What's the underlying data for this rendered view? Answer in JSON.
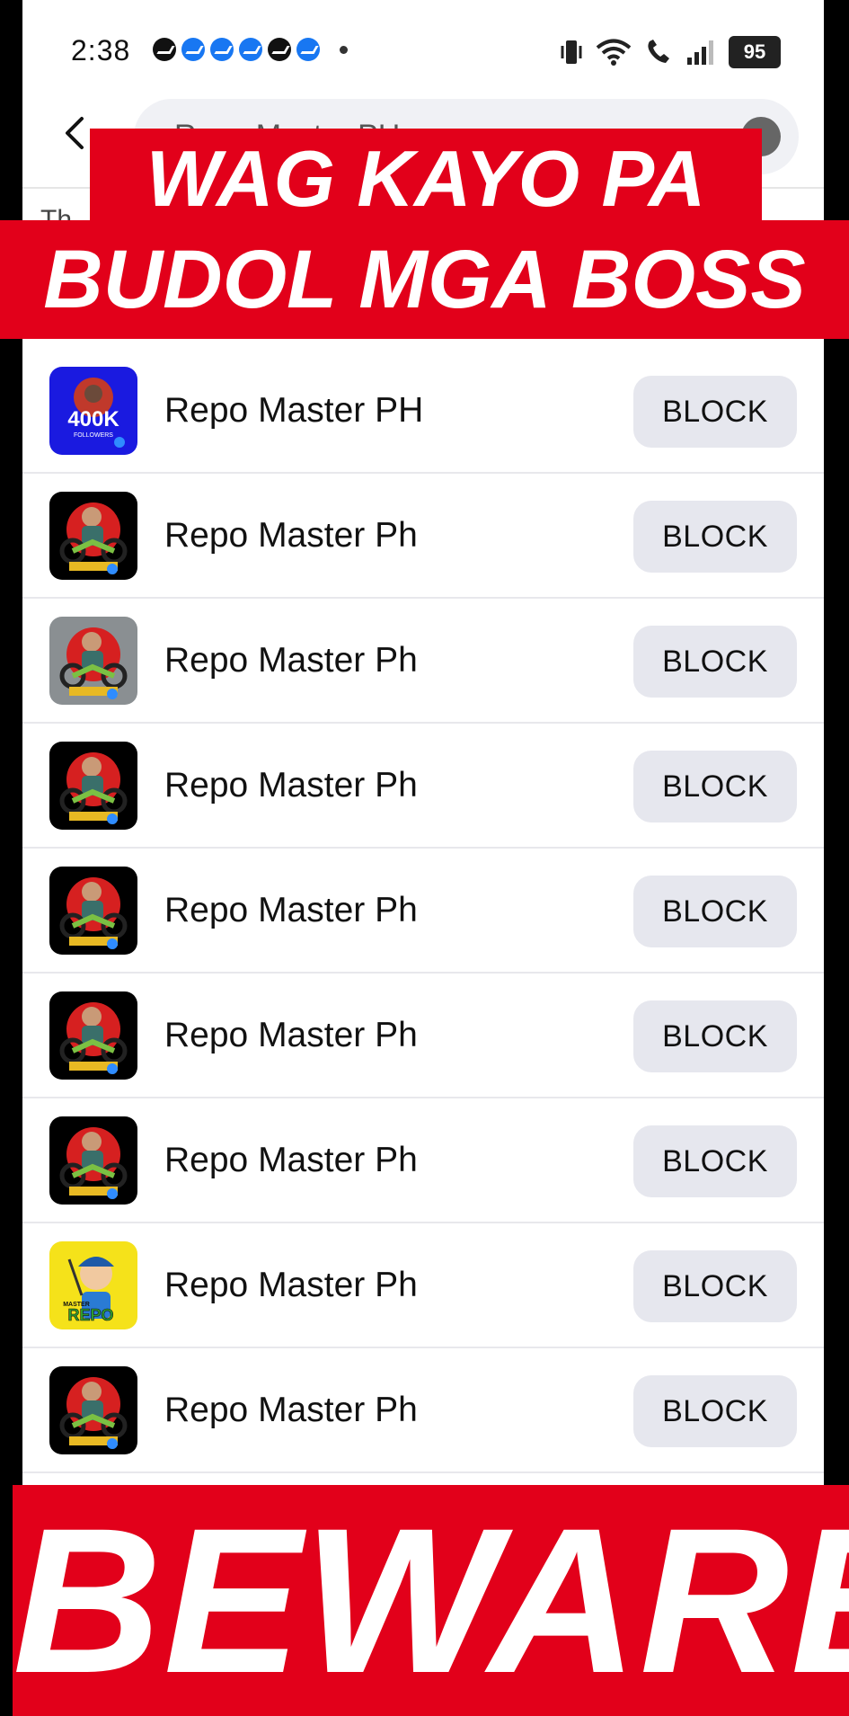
{
  "status_bar": {
    "time": "2:38",
    "battery": "95"
  },
  "search": {
    "query": "Repo Master PH",
    "subtext": "Th"
  },
  "results": [
    {
      "name": "Repo Master PH",
      "action": "BLOCK",
      "avatar": "blue-400k"
    },
    {
      "name": "Repo Master Ph",
      "action": "BLOCK",
      "avatar": "black-moto"
    },
    {
      "name": "Repo Master Ph",
      "action": "BLOCK",
      "avatar": "photo-moto"
    },
    {
      "name": "Repo Master Ph",
      "action": "BLOCK",
      "avatar": "black-moto"
    },
    {
      "name": "Repo Master Ph",
      "action": "BLOCK",
      "avatar": "black-moto"
    },
    {
      "name": "Repo Master Ph",
      "action": "BLOCK",
      "avatar": "black-moto"
    },
    {
      "name": "Repo Master Ph",
      "action": "BLOCK",
      "avatar": "black-moto"
    },
    {
      "name": "Repo Master Ph",
      "action": "BLOCK",
      "avatar": "yellow-cartoon"
    },
    {
      "name": "Repo Master Ph",
      "action": "BLOCK",
      "avatar": "black-moto"
    }
  ],
  "avatar_text": {
    "followers_count": "400K",
    "followers_label": "FOLLOWERS",
    "repo_label": "REPO",
    "master_label": "MASTER"
  },
  "overlay": {
    "line1": "WAG KAYO PA",
    "line2": "BUDOL MGA BOSS",
    "bottom": "BEWARE"
  },
  "colors": {
    "banner_red": "#e2001a",
    "button_bg": "#e6e7ee",
    "avatar_blue": "#1a1ae0",
    "avatar_yellow": "#f5e21a"
  }
}
